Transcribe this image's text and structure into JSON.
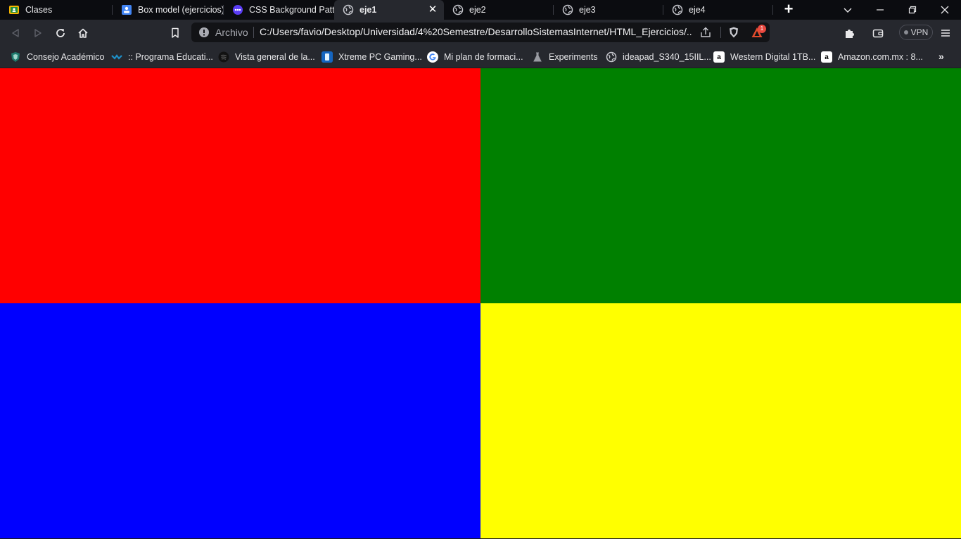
{
  "tabs": [
    {
      "title": "Clases",
      "icon": "classroom-icon"
    },
    {
      "title": "Box model (ejercicios)",
      "icon": "assignment-icon"
    },
    {
      "title": "CSS Background Patte",
      "icon": "patterns-icon"
    },
    {
      "title": "eje1",
      "icon": "globe-icon",
      "active": true
    },
    {
      "title": "eje2",
      "icon": "globe-icon"
    },
    {
      "title": "eje3",
      "icon": "globe-icon"
    },
    {
      "title": "eje4",
      "icon": "globe-icon"
    }
  ],
  "omnibox": {
    "label": "Archivo",
    "url": "C:/Users/favio/Desktop/Universidad/4%20Semestre/DesarrolloSistemasInternet/HTML_Ejercicios/..."
  },
  "rewards_badge": "1",
  "vpn_label": "VPN",
  "bookmarks": [
    {
      "label": "Consejo Académico",
      "icon": "shield-logo-icon"
    },
    {
      "label": ":: Programa Educati...",
      "icon": "program-icon"
    },
    {
      "label": "Vista general de la...",
      "icon": "spotify-icon"
    },
    {
      "label": "Xtreme PC Gaming...",
      "icon": "xtreme-icon"
    },
    {
      "label": "Mi plan de formaci...",
      "icon": "google-icon"
    },
    {
      "label": "Experiments",
      "icon": "flask-icon"
    },
    {
      "label": "ideapad_S340_15IIL...",
      "icon": "globe-icon"
    },
    {
      "label": "Western Digital 1TB...",
      "icon": "amazon-icon"
    },
    {
      "label": "Amazon.com.mx : 8...",
      "icon": "amazon-icon"
    }
  ],
  "quadrants": {
    "top_left": "#ff0000",
    "top_right": "#008000",
    "bottom_left": "#0000ff",
    "bottom_right": "#ffff00"
  }
}
